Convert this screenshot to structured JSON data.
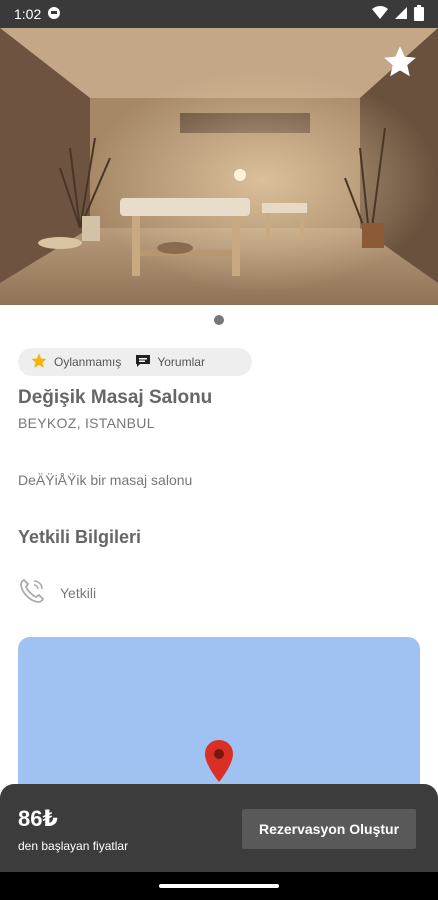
{
  "status_bar": {
    "time": "1:02"
  },
  "hero": {
    "image_description_icon": "spa-room-photo",
    "favorite_icon": "star-icon",
    "page_count": 1,
    "current_page": 1
  },
  "chips": {
    "rating_label": "Oylanmamış",
    "reviews_label": "Yorumlar"
  },
  "salon": {
    "name": "Değişik Masaj Salonu",
    "location": "BEYKOZ, ISTANBUL",
    "description": "DeÄŸiÅŸik bir masaj salonu"
  },
  "authorized": {
    "section_title": "Yetkili Bilgileri",
    "contact_label": "Yetkili"
  },
  "footer": {
    "price": "86₺",
    "price_caption": "den başlayan fiyatlar",
    "reserve_label": "Rezervasyon Oluştur"
  },
  "colors": {
    "accent_star": "#f5b400",
    "map_water": "#a0c2f3",
    "pin": "#d93025",
    "bottom_bar": "#3c3c3c"
  }
}
